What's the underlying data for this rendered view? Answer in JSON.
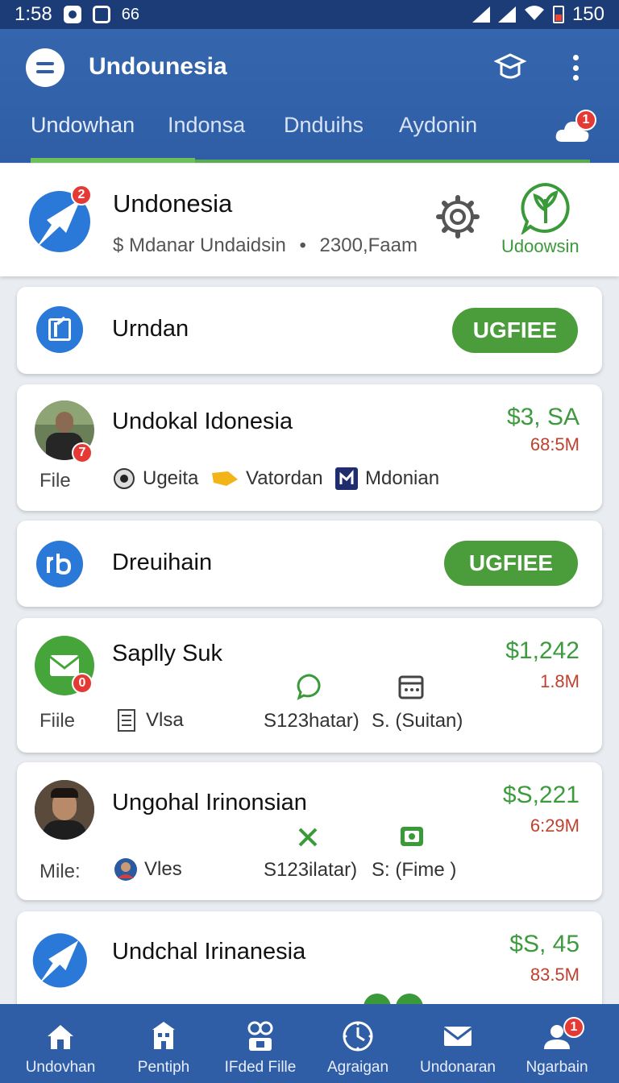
{
  "status_bar": {
    "time": "1:58",
    "notif_count": "66",
    "battery": "150"
  },
  "app_bar": {
    "title": "Undounesia",
    "tabs": [
      {
        "label": "Undowhan"
      },
      {
        "label": "Indonsa"
      },
      {
        "label": "Dnduihs"
      },
      {
        "label": "Aydonin"
      }
    ],
    "cloud_badge": "1"
  },
  "header": {
    "badge": "2",
    "title": "Undonesia",
    "subtitle_left": "$ Mdanar Undaidsin",
    "subtitle_sep": "•",
    "subtitle_right": "2300,Faam",
    "brand_label": "Udoowsin"
  },
  "cards": [
    {
      "title": "Urndan",
      "button": "UGFIEE"
    },
    {
      "title": "Undokal Idonesia",
      "badge": "7",
      "side_label": "File",
      "price": "$3, SA",
      "sub_price": "68:5M",
      "meta": [
        "Ugeita",
        "Vatordan",
        "Mdonian"
      ]
    },
    {
      "title": "Dreuihain",
      "button": "UGFIEE"
    },
    {
      "title": "Saplly Suk",
      "badge": "0",
      "side_label": "Fiile",
      "price": "$1,242",
      "sub_price": "1.8M",
      "meta": [
        "Vlsa",
        "S123hatar)",
        "S. (Suitan)"
      ]
    },
    {
      "title": "Ungohal Irinonsian",
      "side_label": "Mile:",
      "price": "$S,221",
      "sub_price": "6:29M",
      "meta": [
        "Vles",
        "S123ilatar)",
        "S: (Fime )"
      ]
    },
    {
      "title": "Undchal Irinanesia",
      "price": "$S, 45",
      "sub_price": "83.5M"
    }
  ],
  "bottom_nav": [
    {
      "label": "Undovhan",
      "icon": "home-icon"
    },
    {
      "label": "Pentiph",
      "icon": "building-icon"
    },
    {
      "label": "IFded Fille",
      "icon": "files-icon"
    },
    {
      "label": "Agraigan",
      "icon": "clock-icon"
    },
    {
      "label": "Undonaran",
      "icon": "mail-icon"
    },
    {
      "label": "Ngarbain",
      "icon": "people-icon",
      "badge": "1"
    }
  ],
  "colors": {
    "primary_blue": "#2f5ea7",
    "status_bar": "#1c3c78",
    "accent_green": "#4a9d3a",
    "price_red": "#c0412f",
    "badge_red": "#e53935"
  }
}
